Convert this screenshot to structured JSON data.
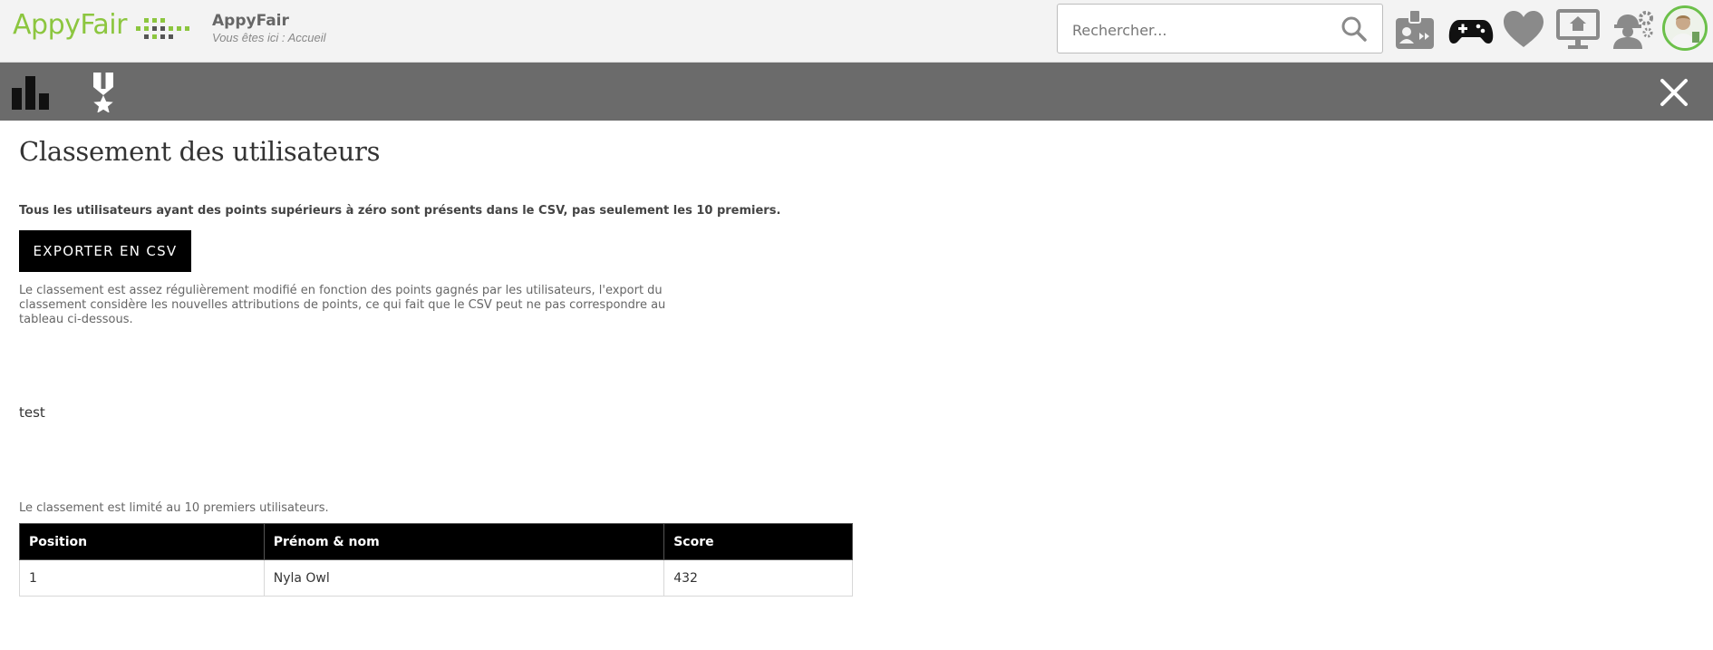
{
  "header": {
    "logo_text": "AppyFair",
    "site_name": "AppyFair",
    "breadcrumb": "Vous êtes ici : Accueil",
    "search_placeholder": "Rechercher...",
    "icons": [
      "search-icon",
      "badge-icon",
      "gamepad-icon",
      "heart-icon",
      "home-screen-icon",
      "worker-settings-icon",
      "user-avatar"
    ],
    "brand_color": "#8cc63f"
  },
  "toolbar": {
    "icons": [
      "bar-chart-icon",
      "medal-icon",
      "close-icon"
    ],
    "background": "#6b6b6b"
  },
  "main": {
    "title": "Classement des utilisateurs",
    "csv_note": "Tous les utilisateurs ayant des points supérieurs à zéro sont présents dans le CSV, pas seulement les 10 premiers.",
    "export_button": "EXPORTER EN CSV",
    "export_info": "Le classement est assez régulièrement modifié en fonction des points gagnés par les utilisateurs, l'export du classement considère les nouvelles attributions de points, ce qui fait que le CSV peut ne pas correspondre au tableau ci-dessous.",
    "free_text": "test",
    "limit_note": "Le classement est limité au 10 premiers utilisateurs."
  },
  "ranking_table": {
    "headers": [
      "Position",
      "Prénom & nom",
      "Score"
    ],
    "rows": [
      [
        "1",
        "Nyla Owl",
        "432"
      ]
    ]
  }
}
